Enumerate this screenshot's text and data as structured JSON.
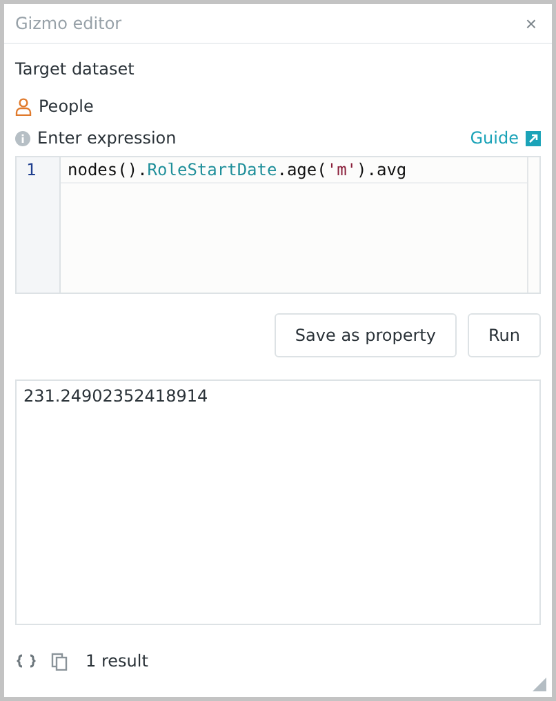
{
  "window": {
    "title": "Gizmo editor",
    "close": "×"
  },
  "target": {
    "label": "Target dataset",
    "dataset": "People"
  },
  "expression": {
    "label": "Enter expression",
    "guide": "Guide"
  },
  "editor": {
    "lines": [
      {
        "number": "1",
        "tokens": [
          {
            "kind": "plain",
            "text": "nodes()."
          },
          {
            "kind": "property",
            "text": "RoleStartDate"
          },
          {
            "kind": "plain",
            "text": ".age("
          },
          {
            "kind": "string",
            "text": "'m'"
          },
          {
            "kind": "plain",
            "text": ").avg"
          }
        ]
      }
    ]
  },
  "buttons": [
    "Save as property",
    "Run"
  ],
  "result": {
    "lines": [
      "231.24902352418914"
    ]
  },
  "footer": {
    "count": "1 result"
  }
}
